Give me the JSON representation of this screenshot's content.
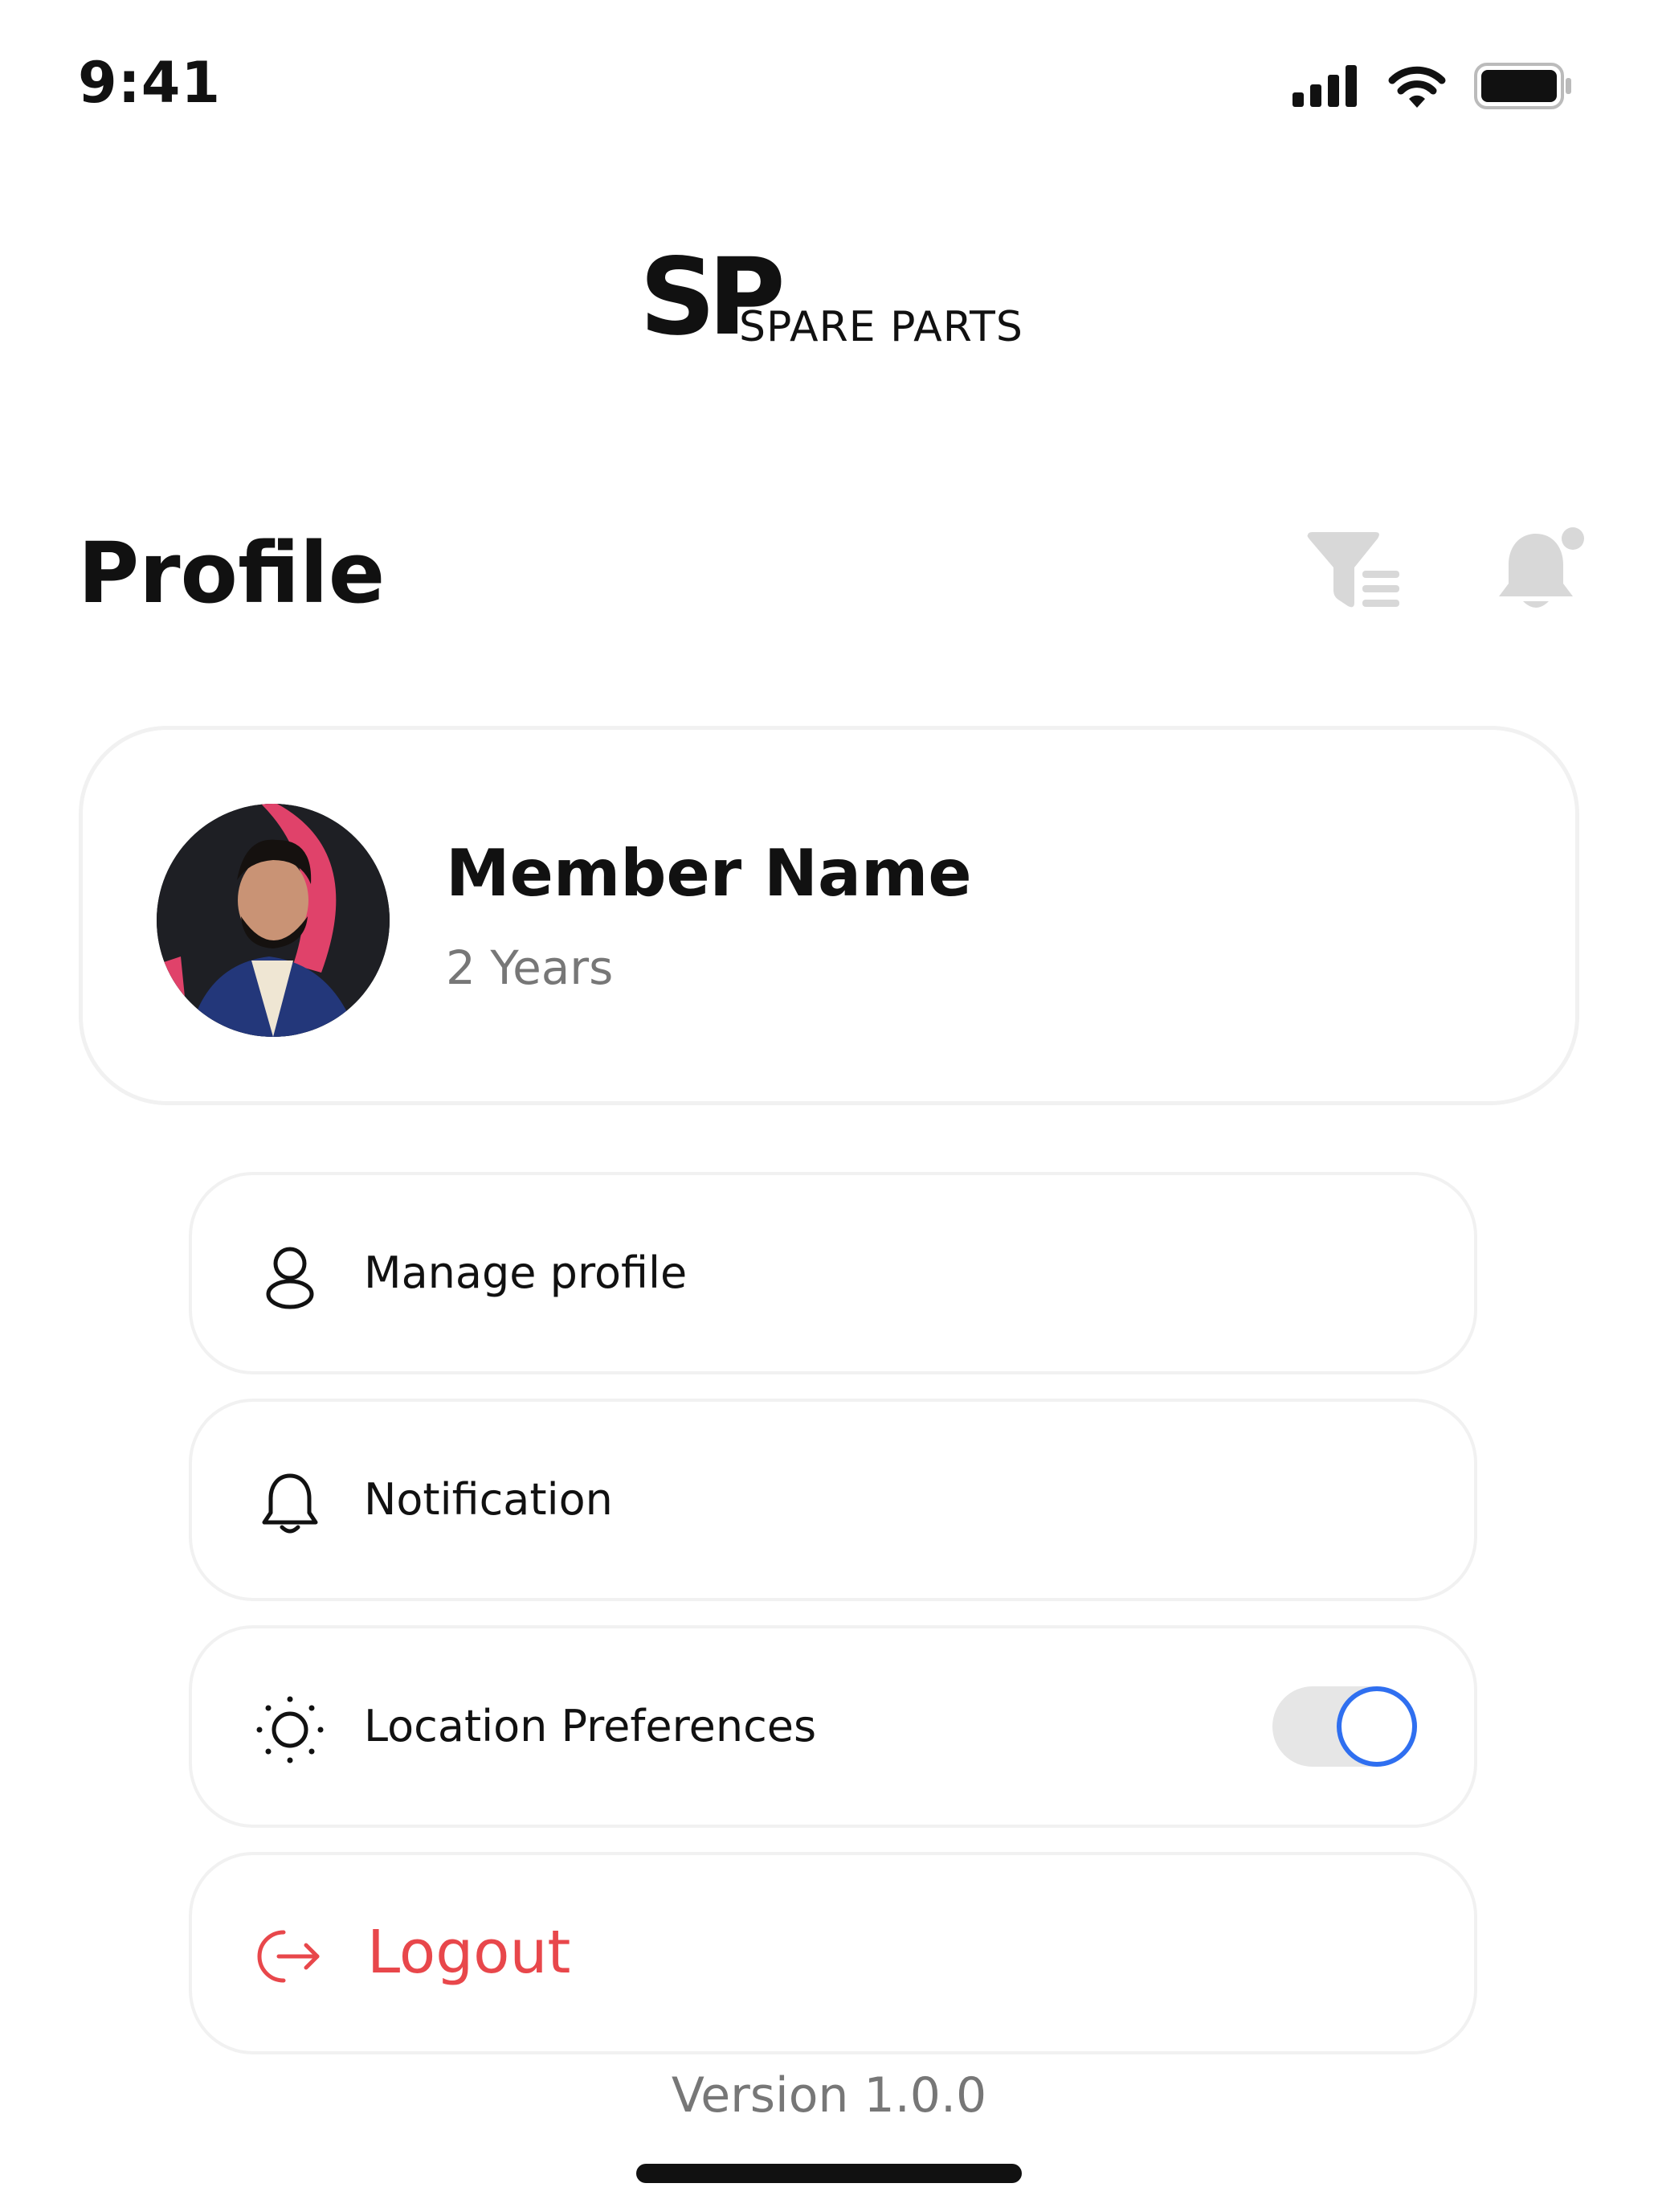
{
  "status_bar": {
    "time": "9:41"
  },
  "logo": {
    "mark": "SP",
    "text": "SPARE PARTS"
  },
  "header": {
    "title": "Profile"
  },
  "profile": {
    "name": "Member Name",
    "tenure": "2 Years"
  },
  "menu": {
    "items": [
      {
        "label": "Manage profile",
        "icon": "user-icon"
      },
      {
        "label": "Notification",
        "icon": "bell-icon"
      },
      {
        "label": "Location Preferences",
        "icon": "sun-icon",
        "toggle_on": true
      }
    ],
    "logout": {
      "label": "Logout",
      "icon": "logout-icon"
    }
  },
  "footer": {
    "version": "Version 1.0.0"
  },
  "colors": {
    "accent": "#2f6ff0",
    "danger": "#e8474b",
    "muted": "#777777"
  }
}
